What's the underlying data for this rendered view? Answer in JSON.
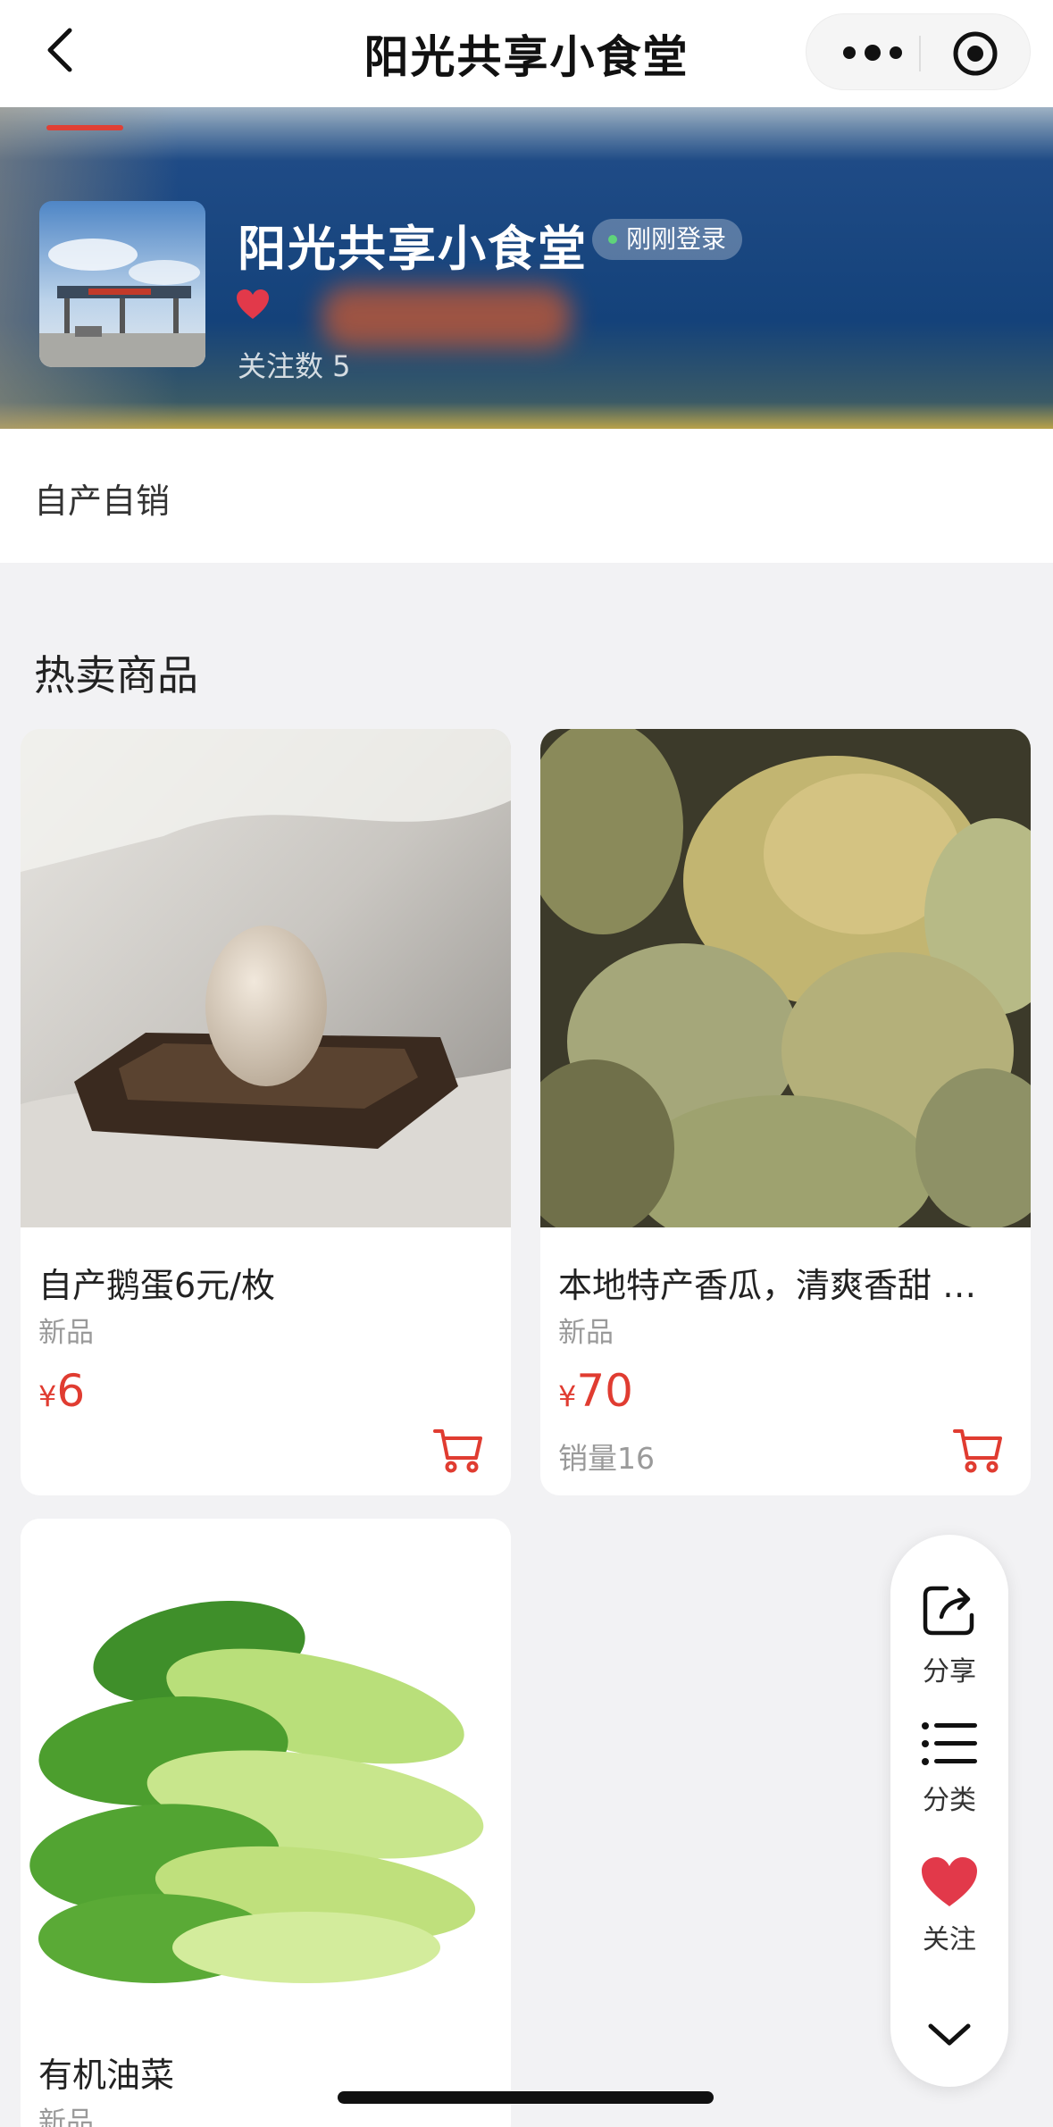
{
  "nav": {
    "title": "阳光共享小食堂"
  },
  "shop": {
    "name": "阳光共享小食堂",
    "status": "刚刚登录",
    "followers": "关注数 5",
    "tagline": "自产自销"
  },
  "section": {
    "title": "热卖商品"
  },
  "products": [
    {
      "name": "自产鹅蛋6元/枚",
      "tag": "新品",
      "currency": "¥",
      "price": "6",
      "sales": "",
      "image": "goose-egg-on-wooden-tray"
    },
    {
      "name": "本地特产香瓜，清爽香甜 …",
      "tag": "新品",
      "currency": "¥",
      "price": "70",
      "sales": "销量16",
      "image": "green-melons"
    },
    {
      "name": "有机油菜",
      "tag": "新品",
      "currency": "¥",
      "price": "",
      "sales": "",
      "image": "bok-choy"
    }
  ],
  "float_menu": {
    "share": "分享",
    "category": "分类",
    "follow": "关注"
  },
  "colors": {
    "accent": "#e03c31",
    "banner": "#1f4b86",
    "status_dot": "#5fd47a"
  },
  "icons": [
    "back-icon",
    "more-icon",
    "target-icon",
    "heart-icon",
    "cart-icon",
    "share-icon",
    "list-icon",
    "chevron-down-icon"
  ]
}
